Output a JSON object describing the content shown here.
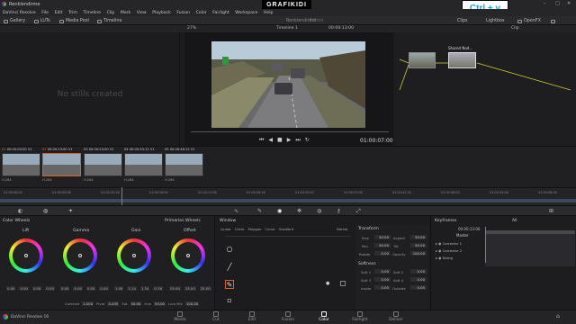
{
  "window": {
    "title": "Renklendirme"
  },
  "menu": [
    "DaVinci Resolve",
    "File",
    "Edit",
    "Trim",
    "Timeline",
    "Clip",
    "Mark",
    "View",
    "Playback",
    "Fusion",
    "Color",
    "Fairlight",
    "Workspace",
    "Help"
  ],
  "project": {
    "name": "Renklendirme",
    "status": "Edited"
  },
  "overlay": {
    "logo": "GRAFIKIDI",
    "shortcut": "Ctrl + v"
  },
  "toolbar": {
    "gallery": "Gallery",
    "luts": "LUTs",
    "media_pool": "Media Pool",
    "timeline": "Timeline",
    "clips": "Clips",
    "lightbox": "Lightbox",
    "openfx": "OpenFX"
  },
  "viewer": {
    "zoom": "27%",
    "timeline_name": "Timeline 1",
    "timecode": "00:00:13:00",
    "end_timecode": "01:00:07:00",
    "clip_mode": "Clip"
  },
  "gallery": {
    "empty_text": "No stills created"
  },
  "nodes": {
    "shared_node": "Shared Nod..."
  },
  "clips": [
    {
      "num": "01",
      "tc": "00:00:00:00",
      "track": "V1",
      "codec": "H.264"
    },
    {
      "num": "02",
      "tc": "00:00:13:00",
      "track": "V1",
      "codec": "H.264"
    },
    {
      "num": "03",
      "tc": "00:00:23:00",
      "track": "V1",
      "codec": "H.264"
    },
    {
      "num": "04",
      "tc": "00:00:33:12",
      "track": "V1",
      "codec": "H.264"
    },
    {
      "num": "05",
      "tc": "00:00:46:12",
      "track": "V1",
      "codec": "H.264"
    }
  ],
  "timeline_ticks": [
    "01:00:00:00",
    "01:00:05:08",
    "01:00:10:16",
    "01:00:16:00",
    "01:00:21:08",
    "01:00:26:16",
    "01:00:32:00",
    "01:00:37:08",
    "01:00:42:16",
    "01:00:48:00",
    "01:00:53:08",
    "01:00:58:16"
  ],
  "color_wheels": {
    "title": "Color Wheels",
    "mode": "Primaries Wheels",
    "wheels": [
      {
        "name": "Lift",
        "values": [
          "0.00",
          "0.00",
          "0.00",
          "0.00"
        ]
      },
      {
        "name": "Gamma",
        "values": [
          "0.00",
          "0.00",
          "0.00",
          "0.00"
        ]
      },
      {
        "name": "Gain",
        "values": [
          "1.00",
          "1.14",
          "1.34",
          "0.76"
        ]
      },
      {
        "name": "Offset",
        "values": [
          "25.00",
          "25.00",
          "25.00"
        ]
      }
    ],
    "bottom": {
      "contrast_label": "Contrast",
      "contrast": "1.000",
      "pivot_label": "Pivot",
      "pivot": "0.435",
      "sat_label": "Sat",
      "sat": "50.00",
      "hue_label": "Hue",
      "hue": "50.00",
      "lummix_label": "Lum Mix",
      "lummix": "100.00"
    }
  },
  "window_panel": {
    "title": "Window",
    "tabs": [
      "Linear",
      "Circle",
      "Polygon",
      "Curve",
      "Gradient"
    ],
    "delete": "Delete"
  },
  "transform": {
    "title": "Transform",
    "fields": [
      {
        "label": "Size",
        "value": "50.00",
        "label2": "Aspect",
        "value2": "50.00"
      },
      {
        "label": "Pan",
        "value": "50.00",
        "label2": "Tilt",
        "value2": "50.00"
      },
      {
        "label": "Rotate",
        "value": "0.00",
        "label2": "Opacity",
        "value2": "100.00"
      }
    ],
    "softness_title": "Softness",
    "softness": [
      {
        "label": "Soft 1",
        "value": "0.00",
        "label2": "Soft 2",
        "value2": "0.00"
      },
      {
        "label": "Soft 3",
        "value": "0.00",
        "label2": "Soft 4",
        "value2": "0.00"
      },
      {
        "label": "Inside",
        "value": "0.00",
        "label2": "Outside",
        "value2": "0.00"
      }
    ]
  },
  "keyframes": {
    "title": "Keyframes",
    "filter": "All",
    "timecode": "00:00:13:00",
    "master": "Master",
    "rows": [
      "Corrector 1",
      "Corrector 2",
      "Sizing"
    ]
  },
  "pages": [
    "Media",
    "Cut",
    "Edit",
    "Fusion",
    "Color",
    "Fairlight",
    "Deliver"
  ],
  "app": {
    "name": "DaVinci Resolve 16"
  }
}
